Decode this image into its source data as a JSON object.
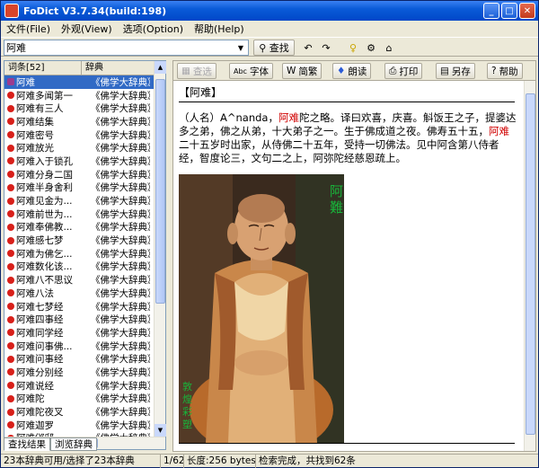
{
  "window": {
    "title": "FoDict  V3.7.34(build:198)"
  },
  "menu": [
    "文件(File)",
    "外观(View)",
    "选项(Option)",
    "帮助(Help)"
  ],
  "search": {
    "value": "阿难",
    "find_label": "查找"
  },
  "list": {
    "headers": [
      "词条[52]",
      "辞典"
    ],
    "rows": [
      {
        "term": "阿难",
        "dict": "《佛学大辞典》",
        "selected": true
      },
      {
        "term": "阿难多闻第一",
        "dict": "《佛学大辞典》"
      },
      {
        "term": "阿难有三人",
        "dict": "《佛学大辞典》"
      },
      {
        "term": "阿难结集",
        "dict": "《佛学大辞典》"
      },
      {
        "term": "阿难密号",
        "dict": "《佛学大辞典》"
      },
      {
        "term": "阿难放光",
        "dict": "《佛学大辞典》"
      },
      {
        "term": "阿难入于锁孔",
        "dict": "《佛学大辞典》"
      },
      {
        "term": "阿难分身二国",
        "dict": "《佛学大辞典》"
      },
      {
        "term": "阿难半身舍利",
        "dict": "《佛学大辞典》"
      },
      {
        "term": "阿难见金为...",
        "dict": "《佛学大辞典》"
      },
      {
        "term": "阿难前世为...",
        "dict": "《佛学大辞典》"
      },
      {
        "term": "阿难奉佛教...",
        "dict": "《佛学大辞典》"
      },
      {
        "term": "阿难感七梦",
        "dict": "《佛学大辞典》"
      },
      {
        "term": "阿难为佛乞...",
        "dict": "《佛学大辞典》"
      },
      {
        "term": "阿难数化该...",
        "dict": "《佛学大辞典》"
      },
      {
        "term": "阿难八不思议",
        "dict": "《佛学大辞典》"
      },
      {
        "term": "阿难八法",
        "dict": "《佛学大辞典》"
      },
      {
        "term": "阿难七梦经",
        "dict": "《佛学大辞典》"
      },
      {
        "term": "阿难四事经",
        "dict": "《佛学大辞典》"
      },
      {
        "term": "阿难同学经",
        "dict": "《佛学大辞典》"
      },
      {
        "term": "阿难问事佛...",
        "dict": "《佛学大辞典》"
      },
      {
        "term": "阿难问事经",
        "dict": "《佛学大辞典》"
      },
      {
        "term": "阿难分别经",
        "dict": "《佛学大辞典》"
      },
      {
        "term": "阿难说经",
        "dict": "《佛学大辞典》"
      },
      {
        "term": "阿难陀",
        "dict": "《佛学大辞典》"
      },
      {
        "term": "阿难陀夜叉",
        "dict": "《佛学大辞典》"
      },
      {
        "term": "阿难迦罗",
        "dict": "《佛学大辞典》"
      },
      {
        "term": "阿难邠邸",
        "dict": "《佛学大辞典》"
      }
    ]
  },
  "tabs": [
    "查找结果",
    "浏览辞典"
  ],
  "viewer_toolbar": {
    "copy": "查选",
    "font": "字体",
    "simp_trad": "简繁",
    "speak": "朗读",
    "print": "打印",
    "save": "另存",
    "help": "帮助"
  },
  "entry": {
    "title": "阿难",
    "body_parts": [
      {
        "t": "（人名）A^nanda，",
        "hl": false
      },
      {
        "t": "阿难",
        "hl": true
      },
      {
        "t": "陀之略。译曰欢喜，庆喜。斛饭王之子，提婆达多之弟，佛之从弟，十大弟子之一。生于佛成道之夜。佛寿五十五，",
        "hl": false
      },
      {
        "t": "阿难",
        "hl": true
      },
      {
        "t": "二十五岁时出家，从侍佛二十五年，受持一切佛法。见中阿含第八侍者经，智度论三，文句二之上，阿弥陀经慈恩疏上。",
        "hl": false
      }
    ],
    "photo_caption_top": "阿難",
    "photo_caption_bottom": "敦煌彩塑"
  },
  "status": {
    "dicts": "23本辞典可用/选择了23本辞典",
    "page": "1/62",
    "length": "长度:256 bytes",
    "message": "检索完成，共找到62条"
  }
}
